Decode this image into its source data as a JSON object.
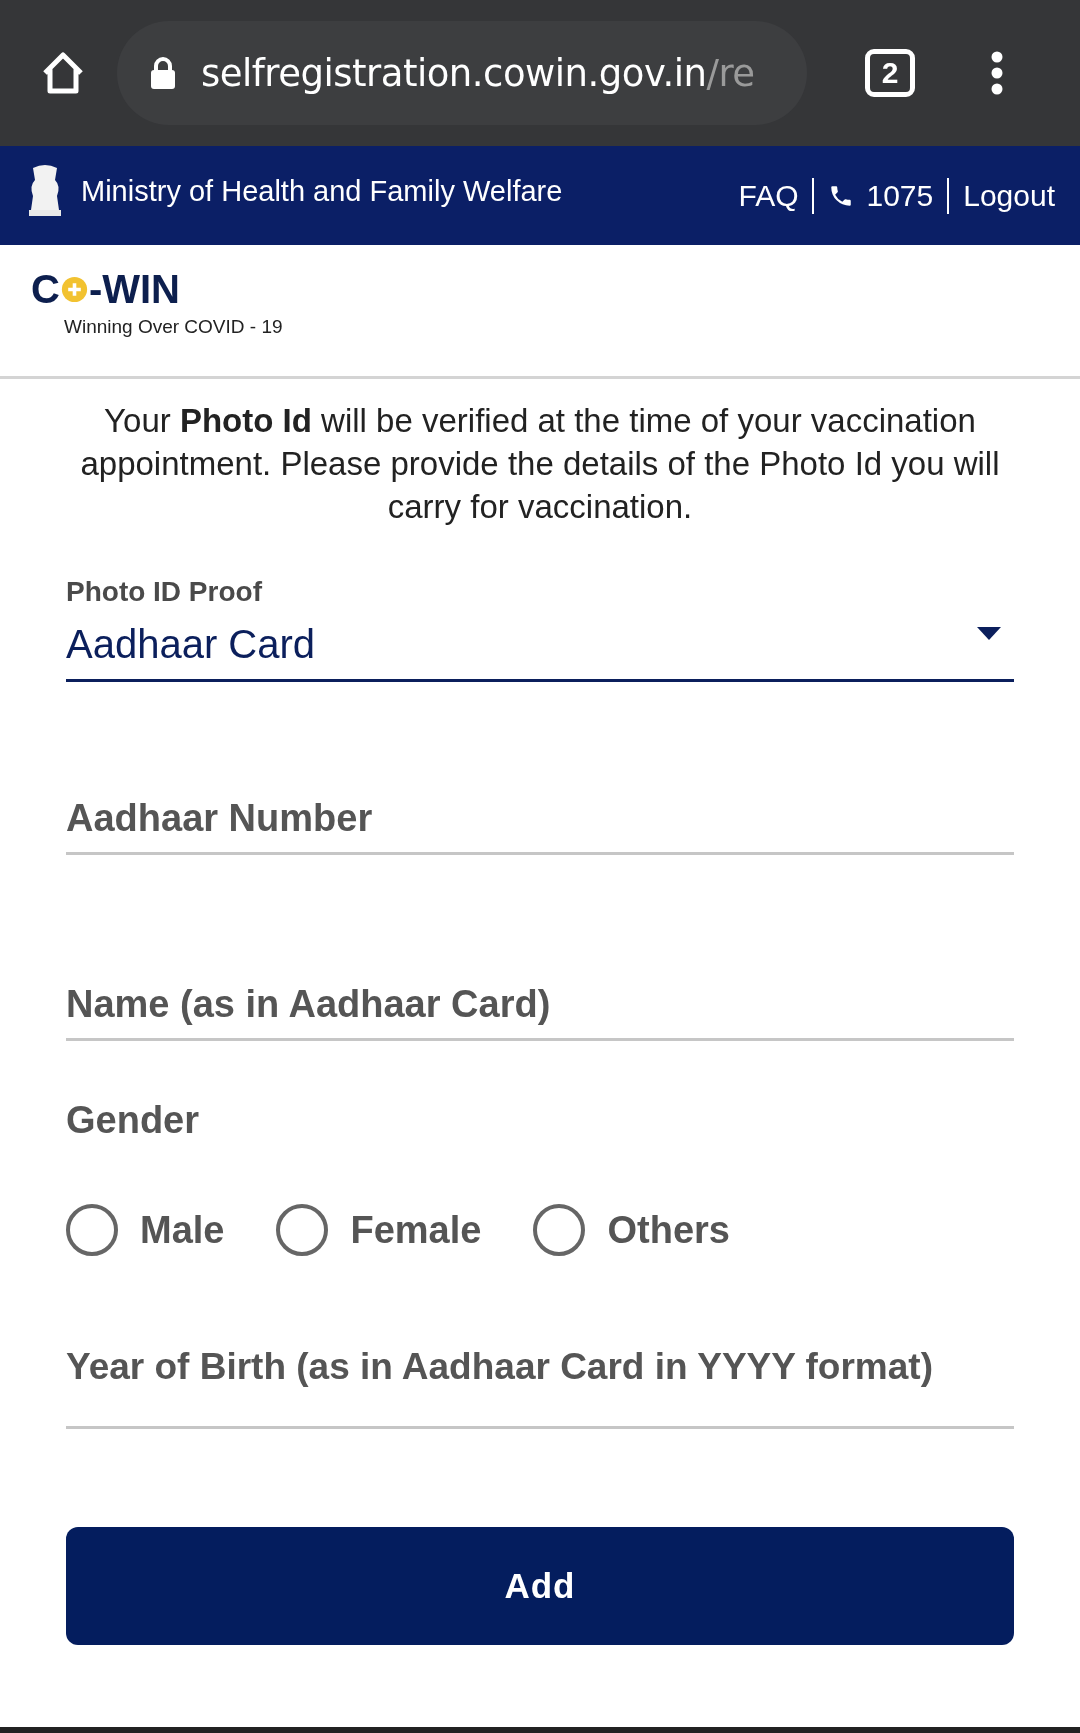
{
  "browser": {
    "url_host": "selfregistration.cowin.gov.in",
    "url_path": "/re",
    "tab_count": "2"
  },
  "header": {
    "title": "Ministry of Health and Family Welfare",
    "links": [
      {
        "kind": "link",
        "label": "FAQ"
      },
      {
        "kind": "phone",
        "label": "1075"
      },
      {
        "kind": "link",
        "label": "Logout"
      }
    ]
  },
  "logo": {
    "prefix": "C",
    "suffix": "-WIN",
    "tagline": "Winning Over COVID - 19"
  },
  "intro": "Your **Photo Id** will be verified at the time of your vaccination appointment. Please provide the details of the Photo Id you will carry for vaccination.",
  "photo_id": {
    "label": "Photo ID Proof",
    "value": "Aadhaar Card"
  },
  "fields": [
    {
      "placeholder": "Aadhaar Number"
    },
    {
      "placeholder": "Name (as in Aadhaar Card)"
    }
  ],
  "gender": {
    "label": "Gender",
    "options": [
      {
        "label": "Male",
        "selected": false
      },
      {
        "label": "Female",
        "selected": false
      },
      {
        "label": "Others",
        "selected": false
      }
    ]
  },
  "year_field": {
    "placeholder": "Year of Birth (as in Aadhaar Card in YYYY format)"
  },
  "button": "Add"
}
